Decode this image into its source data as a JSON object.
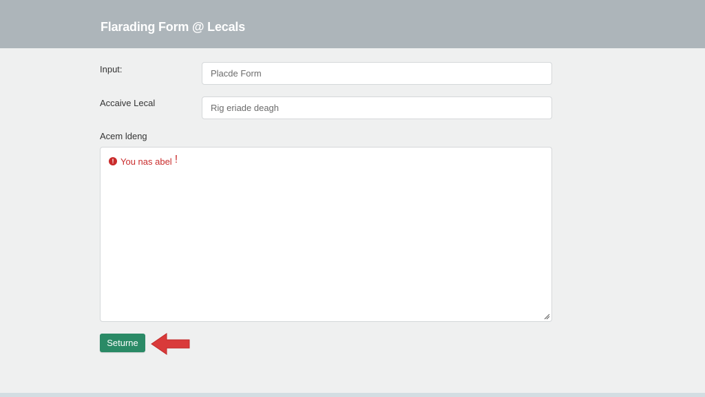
{
  "header": {
    "title": "Flarading Form @ Lecals"
  },
  "form": {
    "fields": [
      {
        "label": "Input:",
        "placeholder": "Placde Form"
      },
      {
        "label": "Accaive Lecal",
        "placeholder": "Rig eriade deagh"
      }
    ],
    "textarea": {
      "label": "Acem ldeng",
      "error": {
        "icon": "error-icon",
        "icon_glyph": "!",
        "text": "You nas abel",
        "bang": "!"
      }
    },
    "submit": {
      "label": "Seturne"
    },
    "pointer_icon": "arrow-left-icon"
  },
  "colors": {
    "header_bg": "#adb5ba",
    "page_bg": "#eff0f0",
    "error": "#c92b2b",
    "submit_bg": "#2a8a66",
    "arrow": "#d93a3a"
  }
}
